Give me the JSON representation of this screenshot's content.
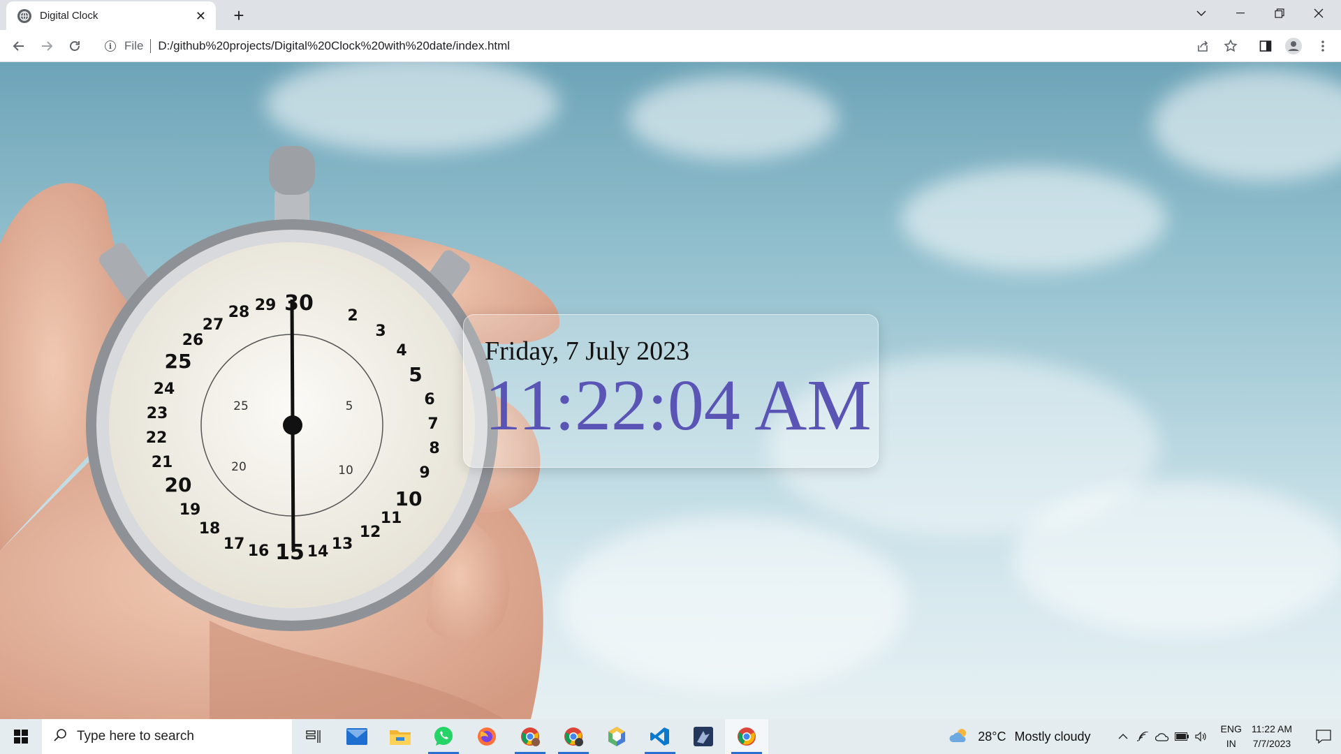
{
  "browser": {
    "tab": {
      "title": "Digital Clock",
      "favicon": "globe-icon"
    },
    "address": {
      "scheme": "File",
      "url": "D:/github%20projects/Digital%20Clock%20with%20date/index.html"
    }
  },
  "page": {
    "date": "Friday, 7 July 2023",
    "time": "11:22:04 AM",
    "time_color": "#5a55b5",
    "background": "hand-holding-stopwatch-against-sky"
  },
  "taskbar": {
    "search_placeholder": "Type here to search",
    "apps": [
      "task-view",
      "mail",
      "file-explorer",
      "whatsapp",
      "firefox",
      "chrome-profile-1",
      "chrome-profile-2",
      "app-cube",
      "vscode",
      "app-dark",
      "chrome"
    ],
    "weather": {
      "temp": "28°C",
      "desc": "Mostly cloudy"
    },
    "lang_line1": "ENG",
    "lang_line2": "IN",
    "clock_time": "11:22 AM",
    "clock_date": "7/7/2023"
  }
}
